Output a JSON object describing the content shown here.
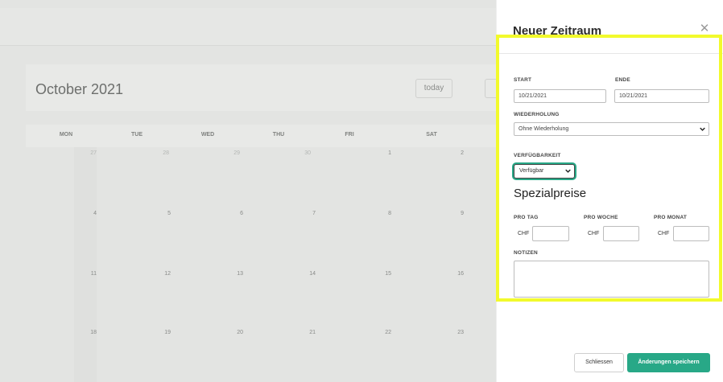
{
  "calendar": {
    "title": "October 2021",
    "today_label": "today",
    "weekdays": [
      "MON",
      "TUE",
      "WED",
      "THU",
      "FRI",
      "SAT"
    ],
    "weeks": [
      [
        "27",
        "28",
        "29",
        "30",
        "1",
        "2"
      ],
      [
        "4",
        "5",
        "6",
        "7",
        "8",
        "9"
      ],
      [
        "11",
        "12",
        "13",
        "14",
        "15",
        "16"
      ],
      [
        "18",
        "19",
        "20",
        "21",
        "22",
        "23"
      ]
    ]
  },
  "panel": {
    "title": "Neuer Zeitraum",
    "start_label": "START",
    "start_value": "10/21/2021",
    "end_label": "ENDE",
    "end_value": "10/21/2021",
    "repeat_label": "WIEDERHOLUNG",
    "repeat_value": "Ohne Wiederholung",
    "availability_label": "VERFÜGBARKEIT",
    "availability_value": "Verfügbar",
    "special_prices_title": "Spezialpreise",
    "per_day_label": "PRO TAG",
    "per_week_label": "PRO WOCHE",
    "per_month_label": "PRO MONAT",
    "currency": "CHF",
    "notes_label": "NOTIZEN",
    "close_button": "Schliessen",
    "save_button": "Änderungen speichern",
    "accent_color": "#28a887",
    "highlight_color": "#f2fa2c"
  }
}
